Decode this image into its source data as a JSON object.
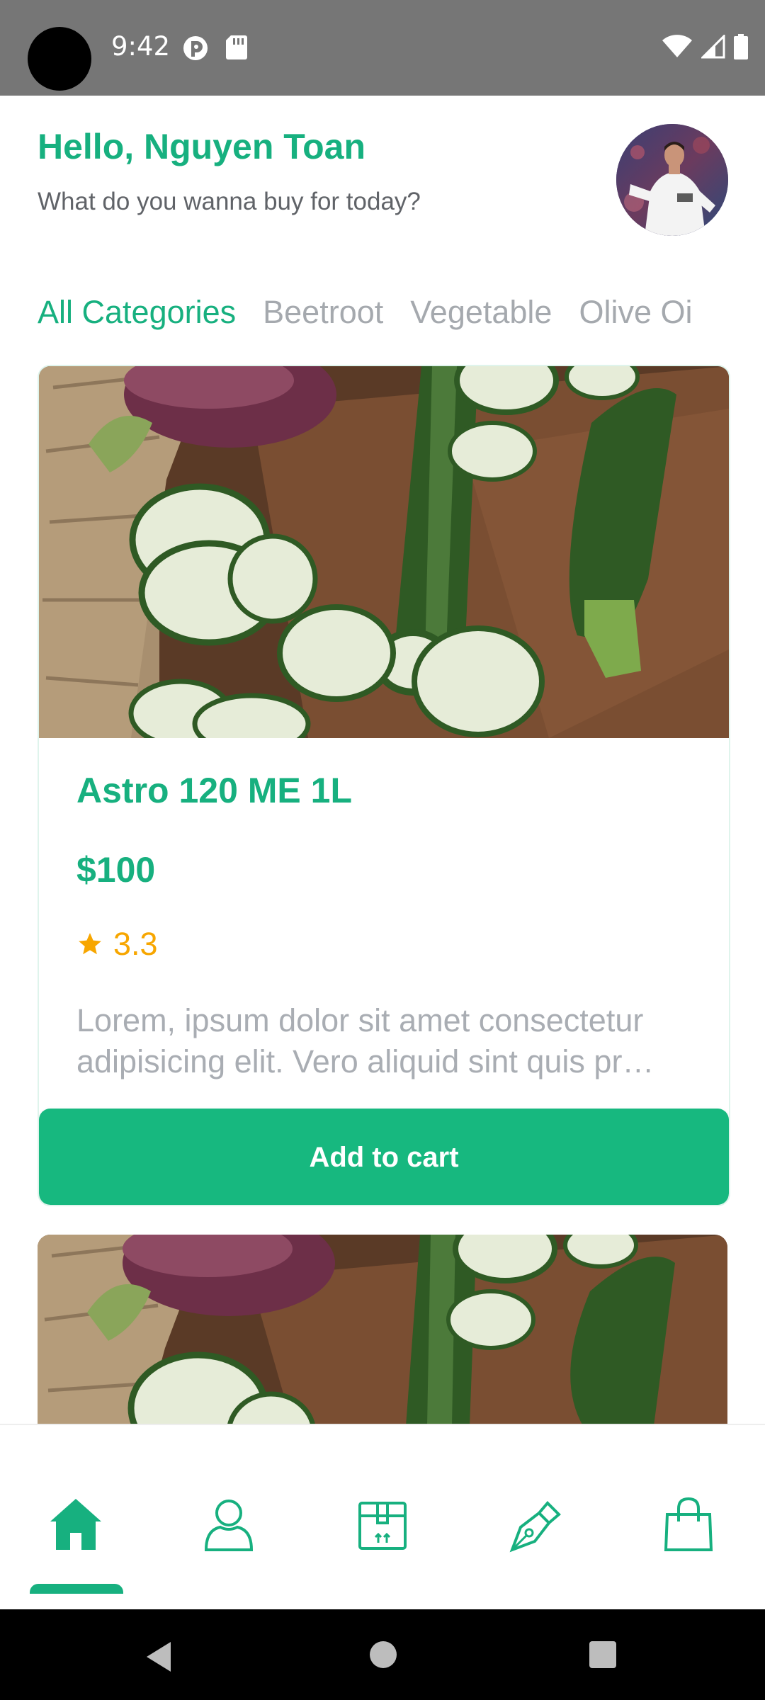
{
  "status_bar": {
    "time": "9:42",
    "icons": [
      "camera-hole",
      "vpn-icon",
      "sd-card-icon",
      "wifi-icon",
      "signal-icon",
      "battery-icon"
    ]
  },
  "header": {
    "greeting": "Hello, Nguyen Toan",
    "subtitle": "What do you wanna buy for today?"
  },
  "categories": [
    {
      "label": "All Categories",
      "active": true
    },
    {
      "label": "Beetroot",
      "active": false
    },
    {
      "label": "Vegetable",
      "active": false
    },
    {
      "label": "Olive Oi",
      "active": false
    }
  ],
  "product": {
    "title": "Astro 120 ME 1L",
    "price": "$100",
    "rating": "3.3",
    "description": "Lorem, ipsum dolor sit amet consectetur adipisicing elit. Vero aliquid sint quis pr…",
    "button_label": "Add to cart"
  },
  "bottom_nav": {
    "items": [
      "home-icon",
      "profile-icon",
      "box-icon",
      "pen-icon",
      "shopping-bag-icon"
    ],
    "active": "home-icon"
  },
  "colors": {
    "accent": "#17B07F",
    "rating": "#F7A600",
    "status_bar": "#767676"
  }
}
